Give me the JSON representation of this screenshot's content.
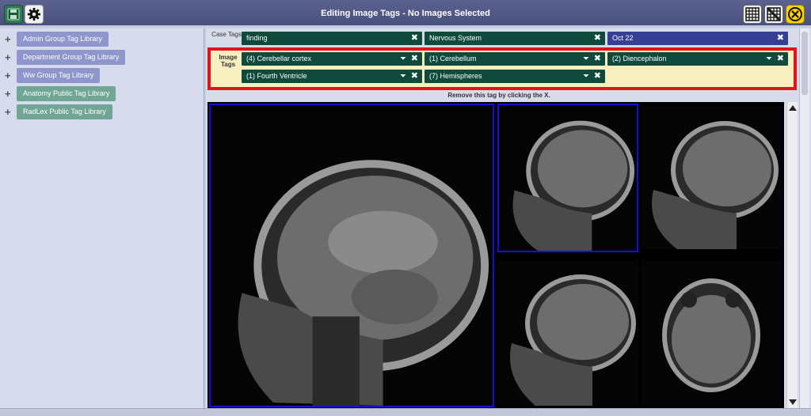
{
  "window": {
    "title": "Editing Image Tags - No Images Selected"
  },
  "toolbar": {
    "save_icon": "floppy-disk-icon",
    "settings_icon": "gear-icon",
    "grid_icon": "grid-icon",
    "no_grid_icon": "grid-off-icon",
    "close_icon": "close-circle-icon"
  },
  "sidebar": {
    "items": [
      {
        "label": "Admin Group Tag Library",
        "type": "group"
      },
      {
        "label": "Department Group Tag Library",
        "type": "group"
      },
      {
        "label": "Ww Group Tag Library",
        "type": "group"
      },
      {
        "label": "Anatomy Public Tag Library",
        "type": "public"
      },
      {
        "label": "RadLex Public Tag Library",
        "type": "public"
      }
    ],
    "expand_symbol": "+"
  },
  "case_tags": {
    "label": "Case Tags",
    "tags": [
      {
        "label": "finding",
        "color": "#0f4a3c"
      },
      {
        "label": "Nervous System",
        "color": "#0f4a3c"
      },
      {
        "label": "Oct 22",
        "color": "#373f92"
      }
    ]
  },
  "image_tags": {
    "label": "Image Tags",
    "tags": [
      {
        "label": "(4) Cerebellar cortex"
      },
      {
        "label": "(1) Cerebellum"
      },
      {
        "label": "(2) Diencephalon"
      },
      {
        "label": "(1) Fourth Ventricle"
      },
      {
        "label": "(7) Hemispheres"
      }
    ]
  },
  "hint": "Remove this tag by clicking the X.",
  "colors": {
    "titlebar": "#4f5582",
    "highlight_border": "#e0141e",
    "highlight_bg": "#f8efc0",
    "selected_border": "#1410d6",
    "tag_green": "#0f4a3c",
    "tag_blue": "#373f92"
  },
  "viewer": {
    "images": [
      {
        "view": "sagittal",
        "selected": true
      },
      {
        "view": "sagittal",
        "selected": true
      },
      {
        "view": "sagittal",
        "selected": false
      },
      {
        "view": "sagittal",
        "selected": false
      },
      {
        "view": "axial",
        "selected": false
      }
    ]
  }
}
